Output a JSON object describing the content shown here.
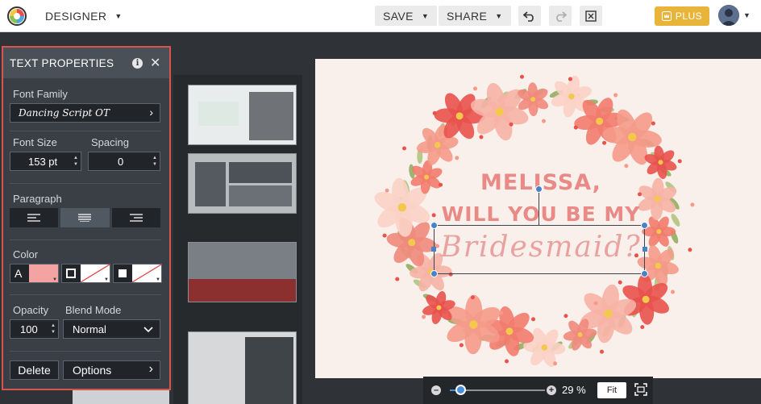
{
  "topbar": {
    "mode_label": "DESIGNER",
    "save_label": "SAVE",
    "share_label": "SHARE",
    "plus_label": "PLUS",
    "icons": [
      "logo-icon",
      "undo-icon",
      "redo-icon",
      "close-design-icon",
      "avatar"
    ]
  },
  "panel": {
    "title": "TEXT PROPERTIES",
    "font_family_label": "Font Family",
    "font_family_value": "Dancing Script OT",
    "font_size_label": "Font Size",
    "font_size_value": "153 pt",
    "spacing_label": "Spacing",
    "spacing_value": "0",
    "paragraph_label": "Paragraph",
    "color_label": "Color",
    "color_text_letter": "A",
    "text_color": "#f4a3a3",
    "opacity_label": "Opacity",
    "opacity_value": "100",
    "blend_label": "Blend Mode",
    "blend_value": "Normal",
    "delete_label": "Delete",
    "options_label": "Options"
  },
  "canvas": {
    "line1": "MELISSA,",
    "line2": "WILL YOU BE MY",
    "line3": "Bridesmaid?",
    "background": "#f9f0ec",
    "text_color": "#e98a86"
  },
  "zoom": {
    "percent": "29 %",
    "fit_label": "Fit",
    "level_fraction": 0.12
  },
  "colors": {
    "accent": "#4a82c9",
    "plus": "#e8b53a",
    "panel_border": "#d9534f"
  }
}
